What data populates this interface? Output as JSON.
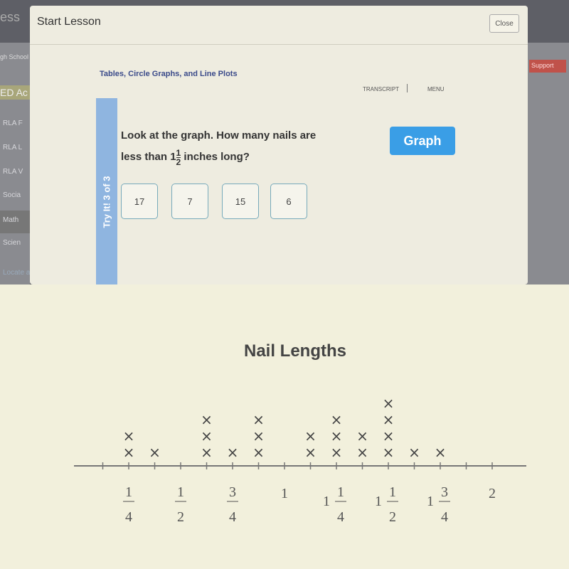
{
  "background": {
    "logo_fragment": "ess",
    "school": "gh School",
    "program": "ED Ac",
    "support": "Support",
    "locate": "Locate a tes",
    "sidebar": [
      "RLA F",
      "RLA L",
      "RLA V",
      "Socia",
      "Math",
      "Scien"
    ]
  },
  "modal": {
    "title": "Start Lesson",
    "close_label": "Close",
    "lesson_title": "Tables, Circle Graphs, and Line Plots",
    "transcript": "TRANSCRIPT",
    "menu": "MENU",
    "progress": "Try It! 3 of 3",
    "question_pre": "Look at the graph. How many nails are",
    "question_mid": "less than 1",
    "frac_num": "1",
    "frac_den": "2",
    "question_post": "inches long?",
    "graph_button": "Graph",
    "answers": [
      "17",
      "7",
      "15",
      "6"
    ]
  },
  "chart_data": {
    "type": "line plot",
    "title": "Nail Lengths",
    "tick_labels": [
      {
        "value": 0.25,
        "whole": "",
        "num": "1",
        "den": "4"
      },
      {
        "value": 0.5,
        "whole": "",
        "num": "1",
        "den": "2"
      },
      {
        "value": 0.75,
        "whole": "",
        "num": "3",
        "den": "4"
      },
      {
        "value": 1,
        "whole": "1",
        "num": "",
        "den": ""
      },
      {
        "value": 1.25,
        "whole": "1",
        "num": "1",
        "den": "4"
      },
      {
        "value": 1.5,
        "whole": "1",
        "num": "1",
        "den": "2"
      },
      {
        "value": 1.75,
        "whole": "1",
        "num": "3",
        "den": "4"
      },
      {
        "value": 2,
        "whole": "2",
        "num": "",
        "den": ""
      }
    ],
    "x": [
      0.25,
      0.375,
      0.625,
      0.75,
      0.875,
      1.125,
      1.25,
      1.375,
      1.5,
      1.625,
      1.75
    ],
    "counts": [
      2,
      1,
      3,
      1,
      3,
      2,
      3,
      2,
      4,
      1,
      1
    ],
    "xlim": [
      0.125,
      2.125
    ],
    "mark": "×",
    "mark_color": "#444444"
  }
}
